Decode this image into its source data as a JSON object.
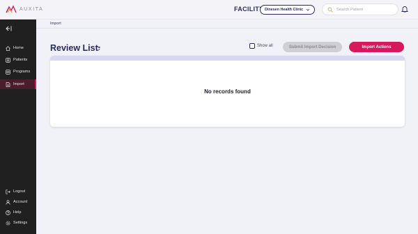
{
  "brand": {
    "logo_text": "AUXITA"
  },
  "header": {
    "facility_label": "FACILITY",
    "facility_selected": "Dinesen Health Clinic",
    "search_placeholder": "Search Patient"
  },
  "sidebar": {
    "items": [
      {
        "label": "Home",
        "icon": "home-icon"
      },
      {
        "label": "Patients",
        "icon": "patients-icon"
      },
      {
        "label": "Programs",
        "icon": "programs-icon"
      },
      {
        "label": "Import",
        "icon": "import-icon",
        "active": true
      }
    ],
    "footer_items": [
      {
        "label": "Logout",
        "icon": "logout-icon"
      },
      {
        "label": "Account",
        "icon": "account-icon"
      },
      {
        "label": "Help",
        "icon": "help-icon"
      },
      {
        "label": "Settings",
        "icon": "settings-icon"
      }
    ]
  },
  "breadcrumb": "Import",
  "main": {
    "title": "Review List",
    "show_all_label": "Show all",
    "show_all_checked": false,
    "submit_label": "Submit Import Decision",
    "import_actions_label": "Import Actions",
    "empty_message": "No records found"
  },
  "colors": {
    "accent": "#d6195b",
    "navy": "#2a2a60",
    "sidebar_bg": "#202020",
    "card_band": "#d9d8f0"
  }
}
